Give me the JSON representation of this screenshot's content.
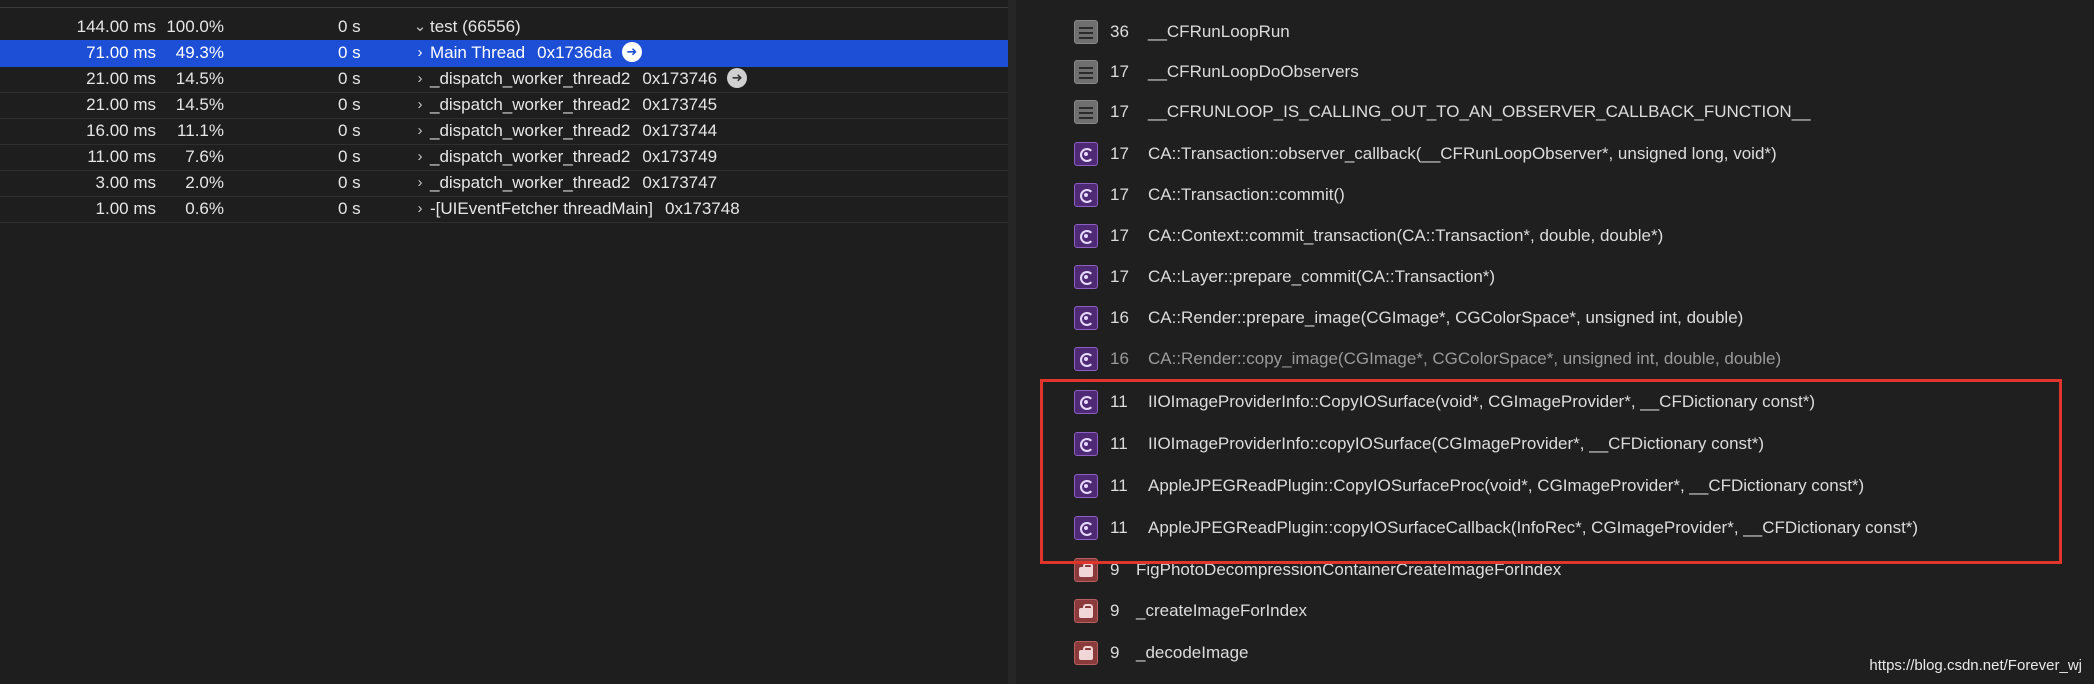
{
  "call_tree": {
    "rows": [
      {
        "weight": "144.00 ms",
        "percent": "100.0%",
        "self": "0 s",
        "chevron": "⌄",
        "name": "test (66556)",
        "thread_id": "",
        "badge": ""
      },
      {
        "weight": "71.00 ms",
        "percent": "49.3%",
        "self": "0 s",
        "chevron": "›",
        "name": "Main Thread",
        "thread_id": "0x1736da",
        "badge": "white"
      },
      {
        "weight": "21.00 ms",
        "percent": "14.5%",
        "self": "0 s",
        "chevron": "›",
        "name": "_dispatch_worker_thread2",
        "thread_id": "0x173746",
        "badge": "grey"
      },
      {
        "weight": "21.00 ms",
        "percent": "14.5%",
        "self": "0 s",
        "chevron": "›",
        "name": "_dispatch_worker_thread2",
        "thread_id": "0x173745",
        "badge": ""
      },
      {
        "weight": "16.00 ms",
        "percent": "11.1%",
        "self": "0 s",
        "chevron": "›",
        "name": "_dispatch_worker_thread2",
        "thread_id": "0x173744",
        "badge": ""
      },
      {
        "weight": "11.00 ms",
        "percent": "7.6%",
        "self": "0 s",
        "chevron": "›",
        "name": "_dispatch_worker_thread2",
        "thread_id": "0x173749",
        "badge": ""
      },
      {
        "weight": "3.00 ms",
        "percent": "2.0%",
        "self": "0 s",
        "chevron": "›",
        "name": "_dispatch_worker_thread2",
        "thread_id": "0x173747",
        "badge": ""
      },
      {
        "weight": "1.00 ms",
        "percent": "0.6%",
        "self": "0 s",
        "chevron": "›",
        "name": "-[UIEventFetcher threadMain]",
        "thread_id": "0x173748",
        "badge": ""
      }
    ],
    "selected_index": 1,
    "badge_glyph": "➜"
  },
  "stack_trace": {
    "frames": [
      {
        "count": "36",
        "symbol": "__CFRunLoopRun",
        "icon": "list"
      },
      {
        "count": "17",
        "symbol": "__CFRunLoopDoObservers",
        "icon": "list"
      },
      {
        "count": "17",
        "symbol": "__CFRUNLOOP_IS_CALLING_OUT_TO_AN_OBSERVER_CALLBACK_FUNCTION__",
        "icon": "list"
      },
      {
        "count": "17",
        "symbol": "CA::Transaction::observer_callback(__CFRunLoopObserver*, unsigned long, void*)",
        "icon": "lib"
      },
      {
        "count": "17",
        "symbol": "CA::Transaction::commit()",
        "icon": "lib"
      },
      {
        "count": "17",
        "symbol": "CA::Context::commit_transaction(CA::Transaction*, double, double*)",
        "icon": "lib"
      },
      {
        "count": "17",
        "symbol": "CA::Layer::prepare_commit(CA::Transaction*)",
        "icon": "lib"
      },
      {
        "count": "16",
        "symbol": "CA::Render::prepare_image(CGImage*, CGColorSpace*, unsigned int, double)",
        "icon": "lib"
      },
      {
        "count": "16",
        "symbol": "CA::Render::copy_image(CGImage*, CGColorSpace*, unsigned int, double, double)",
        "icon": "lib"
      },
      {
        "count": "11",
        "symbol": "IIOImageProviderInfo::CopyIOSurface(void*, CGImageProvider*, __CFDictionary const*)",
        "icon": "lib"
      },
      {
        "count": "11",
        "symbol": "IIOImageProviderInfo::copyIOSurface(CGImageProvider*, __CFDictionary const*)",
        "icon": "lib"
      },
      {
        "count": "11",
        "symbol": "AppleJPEGReadPlugin::CopyIOSurfaceProc(void*, CGImageProvider*, __CFDictionary const*)",
        "icon": "lib"
      },
      {
        "count": "11",
        "symbol": "AppleJPEGReadPlugin::copyIOSurfaceCallback(InfoRec*, CGImageProvider*, __CFDictionary const*)",
        "icon": "lib"
      },
      {
        "count": "9",
        "symbol": "FigPhotoDecompressionContainerCreateImageForIndex",
        "icon": "bag"
      },
      {
        "count": "9",
        "symbol": "_createImageForIndex",
        "icon": "bag"
      },
      {
        "count": "9",
        "symbol": "_decodeImage",
        "icon": "bag"
      }
    ]
  },
  "watermark": "https://blog.csdn.net/Forever_wj",
  "colors": {
    "selection": "#1d4fd6",
    "highlight_border": "#e0352b",
    "background": "#1e1e1e"
  }
}
